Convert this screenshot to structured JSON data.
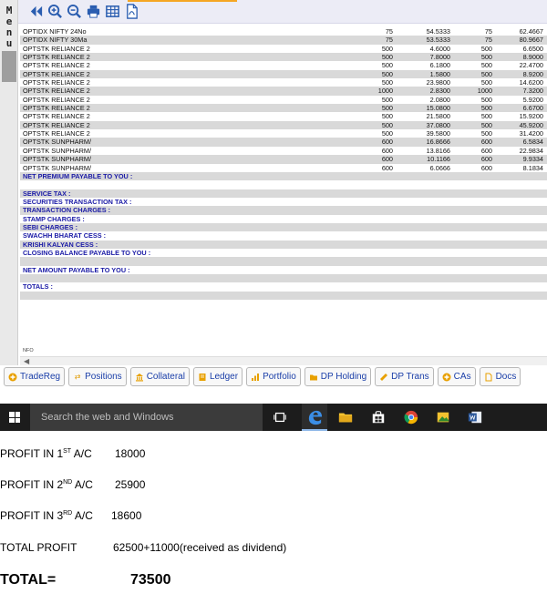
{
  "menu": {
    "letters": [
      "M",
      "e",
      "n",
      "u"
    ]
  },
  "toolbar": {
    "icons": [
      "back-icon",
      "zoom-in-icon",
      "zoom-out-icon",
      "print-icon",
      "table-icon",
      "pdf-icon"
    ]
  },
  "report": {
    "rows": [
      {
        "name": "OPTIDX NIFTY 24No",
        "qty1": "75",
        "rate1": "54.5333",
        "qty2": "75",
        "rate2": "62.4667"
      },
      {
        "name": "OPTIDX NIFTY 30Ma",
        "qty1": "75",
        "rate1": "53.5333",
        "qty2": "75",
        "rate2": "80.9667"
      },
      {
        "name": "OPTSTK RELIANCE 2",
        "qty1": "500",
        "rate1": "4.6000",
        "qty2": "500",
        "rate2": "6.6500"
      },
      {
        "name": "OPTSTK RELIANCE 2",
        "qty1": "500",
        "rate1": "7.8000",
        "qty2": "500",
        "rate2": "8.9000"
      },
      {
        "name": "OPTSTK RELIANCE 2",
        "qty1": "500",
        "rate1": "6.1800",
        "qty2": "500",
        "rate2": "22.4700"
      },
      {
        "name": "OPTSTK RELIANCE 2",
        "qty1": "500",
        "rate1": "1.5800",
        "qty2": "500",
        "rate2": "8.9200"
      },
      {
        "name": "OPTSTK RELIANCE 2",
        "qty1": "500",
        "rate1": "23.9800",
        "qty2": "500",
        "rate2": "14.6200"
      },
      {
        "name": "OPTSTK RELIANCE 2",
        "qty1": "1000",
        "rate1": "2.8300",
        "qty2": "1000",
        "rate2": "7.3200"
      },
      {
        "name": "OPTSTK RELIANCE 2",
        "qty1": "500",
        "rate1": "2.0800",
        "qty2": "500",
        "rate2": "5.9200"
      },
      {
        "name": "OPTSTK RELIANCE 2",
        "qty1": "500",
        "rate1": "15.0800",
        "qty2": "500",
        "rate2": "6.6700"
      },
      {
        "name": "OPTSTK RELIANCE 2",
        "qty1": "500",
        "rate1": "21.5800",
        "qty2": "500",
        "rate2": "15.9200"
      },
      {
        "name": "OPTSTK RELIANCE 2",
        "qty1": "500",
        "rate1": "37.0800",
        "qty2": "500",
        "rate2": "45.9200"
      },
      {
        "name": "OPTSTK RELIANCE 2",
        "qty1": "500",
        "rate1": "39.5800",
        "qty2": "500",
        "rate2": "31.4200"
      },
      {
        "name": "OPTSTK SUNPHARM/",
        "qty1": "600",
        "rate1": "16.8666",
        "qty2": "600",
        "rate2": "6.5834"
      },
      {
        "name": "OPTSTK SUNPHARM/",
        "qty1": "600",
        "rate1": "13.8166",
        "qty2": "600",
        "rate2": "22.9834"
      },
      {
        "name": "OPTSTK SUNPHARM/",
        "qty1": "600",
        "rate1": "10.1166",
        "qty2": "600",
        "rate2": "9.9334"
      },
      {
        "name": "OPTSTK SUNPHARM/",
        "qty1": "600",
        "rate1": "6.0666",
        "qty2": "600",
        "rate2": "8.1834"
      }
    ],
    "summary": [
      {
        "label": "NET PREMIUM PAYABLE TO YOU :"
      },
      {
        "label": ""
      },
      {
        "label": "SERVICE TAX :"
      },
      {
        "label": "SECURITIES TRANSACTION TAX :"
      },
      {
        "label": "TRANSACTION CHARGES :"
      },
      {
        "label": "STAMP CHARGES :"
      },
      {
        "label": "SEBI CHARGES :"
      },
      {
        "label": "SWACHH BHARAT CESS :"
      },
      {
        "label": "KRISHI KALYAN CESS :"
      },
      {
        "label": "CLOSING BALANCE PAYABLE TO YOU :"
      },
      {
        "label": ""
      },
      {
        "label": "NET AMOUNT PAYABLE TO YOU :"
      },
      {
        "label": ""
      },
      {
        "label": "TOTALS :"
      },
      {
        "label": ""
      }
    ],
    "footer_label": "NFO"
  },
  "tabs": [
    {
      "label": "TradeReg",
      "icon": "plus-circle-icon"
    },
    {
      "label": "Positions",
      "icon": "arrows-icon"
    },
    {
      "label": "Collateral",
      "icon": "bank-icon"
    },
    {
      "label": "Ledger",
      "icon": "book-icon"
    },
    {
      "label": "Portfolio",
      "icon": "chart-icon"
    },
    {
      "label": "DP Holding",
      "icon": "folder-icon"
    },
    {
      "label": "DP Trans",
      "icon": "transfer-icon"
    },
    {
      "label": "CAs",
      "icon": "plus-circle-icon"
    },
    {
      "label": "Docs",
      "icon": "document-icon"
    }
  ],
  "taskbar": {
    "search_placeholder": "Search the web and Windows"
  },
  "notes": {
    "profit1_prefix": "PROFIT IN 1",
    "profit1_sup": "ST",
    "profit1_suffix": " A/C",
    "profit1_value": "18000",
    "profit2_prefix": "PROFIT IN 2",
    "profit2_sup": "ND",
    "profit2_suffix": " A/C",
    "profit2_value": "25900",
    "profit3_prefix": "PROFIT IN 3",
    "profit3_sup": "RD",
    "profit3_suffix": " A/C",
    "profit3_value": "18600",
    "total_profit_label": "TOTAL PROFIT",
    "total_profit_value": "62500+11000(received as dividend)",
    "total_label": "TOTAL=",
    "total_value": "73500"
  }
}
